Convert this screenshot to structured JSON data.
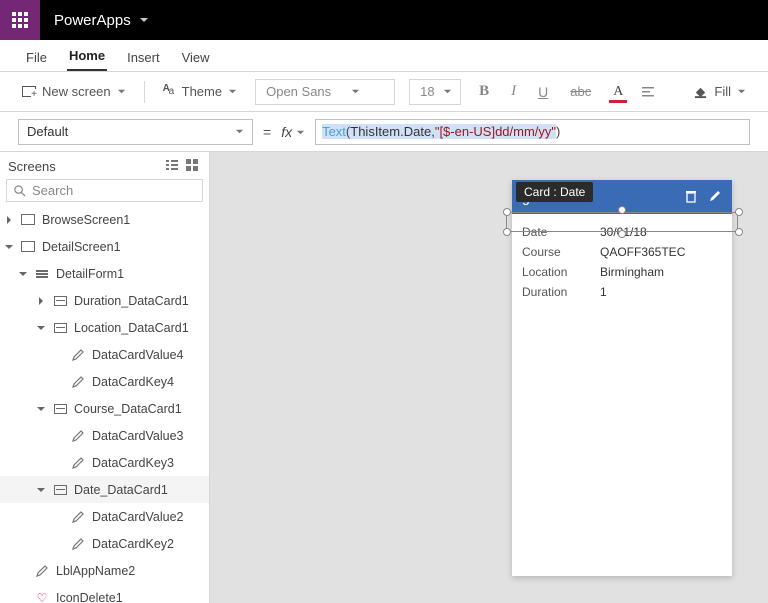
{
  "brand": {
    "name": "PowerApps"
  },
  "menus": {
    "file": "File",
    "home": "Home",
    "insert": "Insert",
    "view": "View"
  },
  "ribbon": {
    "new_screen": "New screen",
    "theme": "Theme",
    "font_family": "Open Sans",
    "font_size": "18",
    "fill": "Fill"
  },
  "formula": {
    "property": "Default",
    "fx_label": "fx",
    "tokens": {
      "fn": "Text",
      "open": "(",
      "arg1a": "ThisItem",
      "dot": ".",
      "arg1b": "Date",
      "comma": ",",
      "str": "\"[$-en-US]dd/mm/yy\"",
      "close": ")"
    }
  },
  "sidebar": {
    "title": "Screens",
    "search_placeholder": "Search",
    "tree": [
      {
        "depth": 0,
        "expand": "closed",
        "icon": "rect",
        "label": "BrowseScreen1"
      },
      {
        "depth": 0,
        "expand": "open",
        "icon": "rect",
        "label": "DetailScreen1"
      },
      {
        "depth": 1,
        "expand": "open",
        "icon": "form",
        "label": "DetailForm1"
      },
      {
        "depth": 2,
        "expand": "closed",
        "icon": "card",
        "label": "Duration_DataCard1"
      },
      {
        "depth": 2,
        "expand": "open",
        "icon": "card",
        "label": "Location_DataCard1"
      },
      {
        "depth": 3,
        "expand": "none",
        "icon": "pencil",
        "label": "DataCardValue4"
      },
      {
        "depth": 3,
        "expand": "none",
        "icon": "pencil",
        "label": "DataCardKey4"
      },
      {
        "depth": 2,
        "expand": "open",
        "icon": "card",
        "label": "Course_DataCard1"
      },
      {
        "depth": 3,
        "expand": "none",
        "icon": "pencil",
        "label": "DataCardValue3"
      },
      {
        "depth": 3,
        "expand": "none",
        "icon": "pencil",
        "label": "DataCardKey3"
      },
      {
        "depth": 2,
        "expand": "open",
        "icon": "card",
        "label": "Date_DataCard1",
        "selected": true
      },
      {
        "depth": 3,
        "expand": "none",
        "icon": "pencil",
        "label": "DataCardValue2"
      },
      {
        "depth": 3,
        "expand": "none",
        "icon": "pencil",
        "label": "DataCardKey2"
      },
      {
        "depth": 1,
        "expand": "none",
        "icon": "pencil",
        "label": "LblAppName2"
      },
      {
        "depth": 1,
        "expand": "none",
        "icon": "heart",
        "label": "IconDelete1"
      }
    ]
  },
  "canvas": {
    "tooltip": "Card : Date",
    "header_title": "gEvents",
    "rows": [
      {
        "key": "Date",
        "value": "30/01/18"
      },
      {
        "key": "Course",
        "value": "QAOFF365TEC"
      },
      {
        "key": "Location",
        "value": "Birmingham"
      },
      {
        "key": "Duration",
        "value": "1"
      }
    ]
  }
}
